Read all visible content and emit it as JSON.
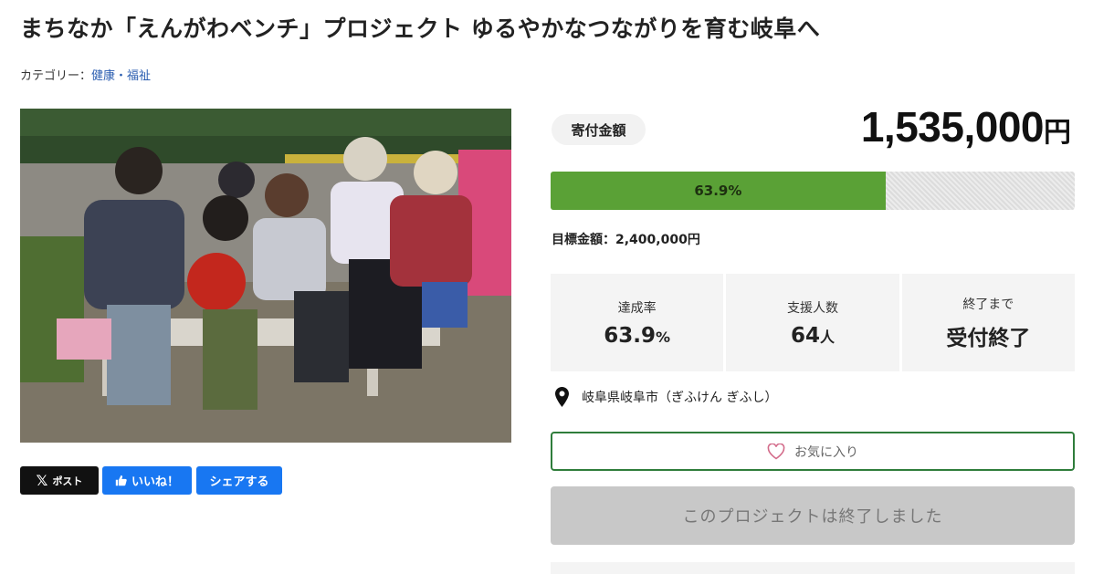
{
  "page": {
    "title": "まちなか「えんがわベンチ」プロジェクト ゆるやかなつながりを育む岐阜へ",
    "category_prefix": "カテゴリー：",
    "category_link": "健康・福祉"
  },
  "share": {
    "x_label": "ポスト",
    "like_label": "いいね！",
    "share_label": "シェアする"
  },
  "donation": {
    "label": "寄付金額",
    "amount": "1,535,000",
    "unit": "円",
    "progress_text": "63.9%",
    "progress_fraction": 0.639,
    "target_text": "目標金額：2,400,000円",
    "accent_color": "#5aa136"
  },
  "stats": [
    {
      "label": "達成率",
      "value": "63.9",
      "unit": "%"
    },
    {
      "label": "支援人数",
      "value": "64",
      "unit": "人"
    },
    {
      "label": "終了まで",
      "value": "受付終了",
      "unit": ""
    }
  ],
  "location": {
    "icon": "map-pin-icon",
    "text": "岐阜県岐阜市（ぎふけん ぎふし）"
  },
  "buttons": {
    "favorite_label": "お気に入り",
    "ended_label": "このプロジェクトは終了しました"
  }
}
